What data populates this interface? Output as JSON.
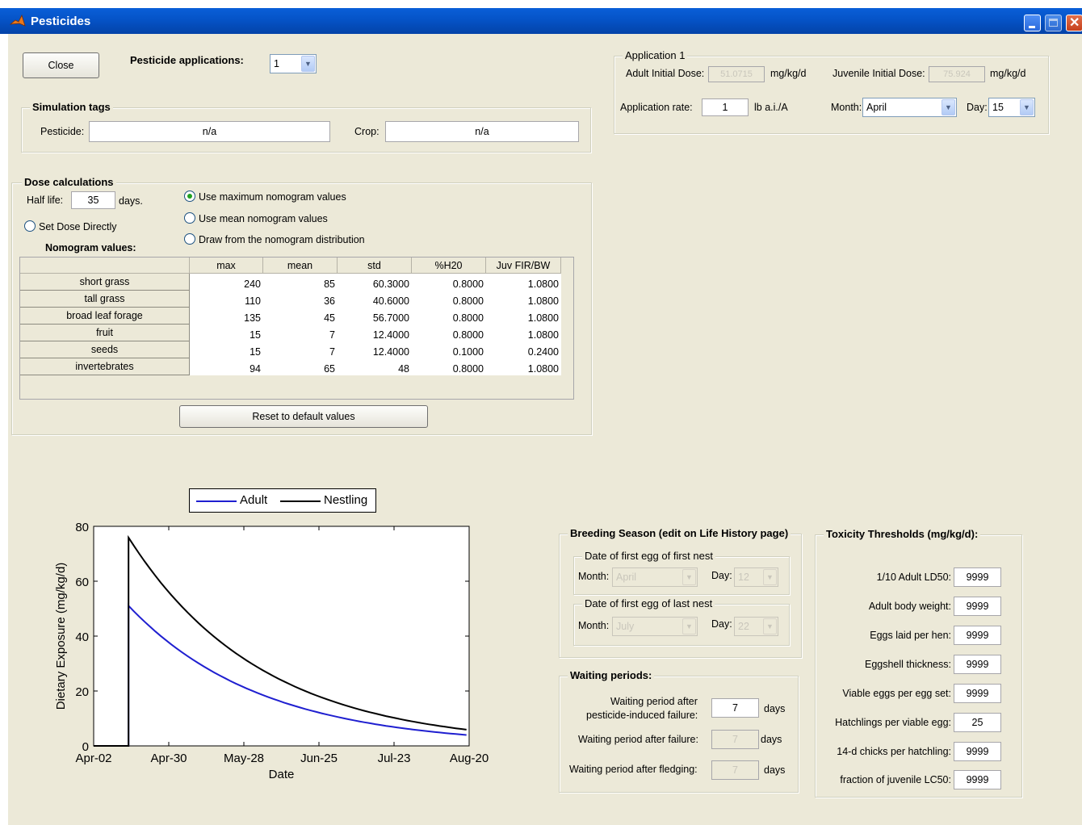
{
  "window": {
    "title": "Pesticides"
  },
  "top": {
    "close_label": "Close",
    "applications_label": "Pesticide applications:",
    "applications_value": "1"
  },
  "sim_tags": {
    "title": "Simulation tags",
    "pesticide_label": "Pesticide:",
    "pesticide_value": "n/a",
    "crop_label": "Crop:",
    "crop_value": "n/a"
  },
  "application": {
    "title": "Application 1",
    "adult_dose_label": "Adult Initial Dose:",
    "adult_dose_value": "51.0715",
    "adult_dose_unit": "mg/kg/d",
    "juvenile_dose_label": "Juvenile Initial Dose:",
    "juvenile_dose_value": "75.924",
    "juvenile_dose_unit": "mg/kg/d",
    "rate_label": "Application rate:",
    "rate_value": "1",
    "rate_unit": "lb a.i./A",
    "month_label": "Month:",
    "month_value": "April",
    "day_label": "Day:",
    "day_value": "15"
  },
  "dose": {
    "title": "Dose calculations",
    "half_life_label": "Half life:",
    "half_life_value": "35",
    "half_life_unit": "days.",
    "set_direct_label": "Set Dose Directly",
    "opt_max": "Use maximum nomogram values",
    "opt_mean": "Use mean nomogram values",
    "opt_draw": "Draw from the nomogram distribution",
    "nomogram_label": "Nomogram values:",
    "reset_label": "Reset to default values",
    "table": {
      "columns": [
        "max",
        "mean",
        "std",
        "%H20",
        "Juv FIR/BW"
      ],
      "rows": [
        {
          "name": "short grass",
          "values": [
            "240",
            "85",
            "60.3000",
            "0.8000",
            "1.0800"
          ]
        },
        {
          "name": "tall grass",
          "values": [
            "110",
            "36",
            "40.6000",
            "0.8000",
            "1.0800"
          ]
        },
        {
          "name": "broad leaf forage",
          "values": [
            "135",
            "45",
            "56.7000",
            "0.8000",
            "1.0800"
          ]
        },
        {
          "name": "fruit",
          "values": [
            "15",
            "7",
            "12.4000",
            "0.8000",
            "1.0800"
          ]
        },
        {
          "name": "seeds",
          "values": [
            "15",
            "7",
            "12.4000",
            "0.1000",
            "0.2400"
          ]
        },
        {
          "name": "invertebrates",
          "values": [
            "94",
            "65",
            "48",
            "0.8000",
            "1.0800"
          ]
        }
      ]
    }
  },
  "breeding": {
    "title": "Breeding Season (edit on Life History page)",
    "first_title": "Date of first egg of first nest",
    "first_month_label": "Month:",
    "first_month_value": "April",
    "first_day_label": "Day:",
    "first_day_value": "12",
    "last_title": "Date of first egg of last nest",
    "last_month_label": "Month:",
    "last_month_value": "July",
    "last_day_label": "Day:",
    "last_day_value": "22"
  },
  "waiting": {
    "title": "Waiting periods:",
    "p1_label_a": "Waiting period after",
    "p1_label_b": "pesticide-induced failure:",
    "p1_value": "7",
    "p2_label": "Waiting period after failure:",
    "p2_value": "7",
    "p3_label": "Waiting period after fledging:",
    "p3_value": "7",
    "unit": "days"
  },
  "toxicity": {
    "title": "Toxicity Thresholds (mg/kg/d):",
    "items": [
      {
        "label": "1/10 Adult LD50:",
        "value": "9999"
      },
      {
        "label": "Adult body weight:",
        "value": "9999"
      },
      {
        "label": "Eggs laid per hen:",
        "value": "9999"
      },
      {
        "label": "Eggshell thickness:",
        "value": "9999"
      },
      {
        "label": "Viable eggs per egg set:",
        "value": "9999"
      },
      {
        "label": "Hatchlings per viable egg:",
        "value": "25"
      },
      {
        "label": "14-d chicks per hatchling:",
        "value": "9999"
      },
      {
        "label": "fraction of juvenile LC50:",
        "value": "9999"
      }
    ]
  },
  "chart_data": {
    "type": "line",
    "xlabel": "Date",
    "ylabel": "Dietary Exposure (mg/kg/d)",
    "ylim": [
      0,
      80
    ],
    "yticks": [
      "0",
      "20",
      "40",
      "60",
      "80"
    ],
    "xticks": [
      "Apr-02",
      "Apr-30",
      "May-28",
      "Jun-25",
      "Jul-23",
      "Aug-20"
    ],
    "x_days_from_apr02": [
      0,
      13,
      28,
      56,
      84,
      112,
      140
    ],
    "series": [
      {
        "name": "Adult",
        "color": "#1f1fd0",
        "values": [
          0,
          51.07,
          38.1,
          21.6,
          12.2,
          6.9,
          3.9
        ]
      },
      {
        "name": "Nestling",
        "color": "#000000",
        "values": [
          0,
          75.92,
          56.6,
          32.1,
          18.1,
          10.3,
          5.8
        ]
      }
    ],
    "legend": "top"
  }
}
